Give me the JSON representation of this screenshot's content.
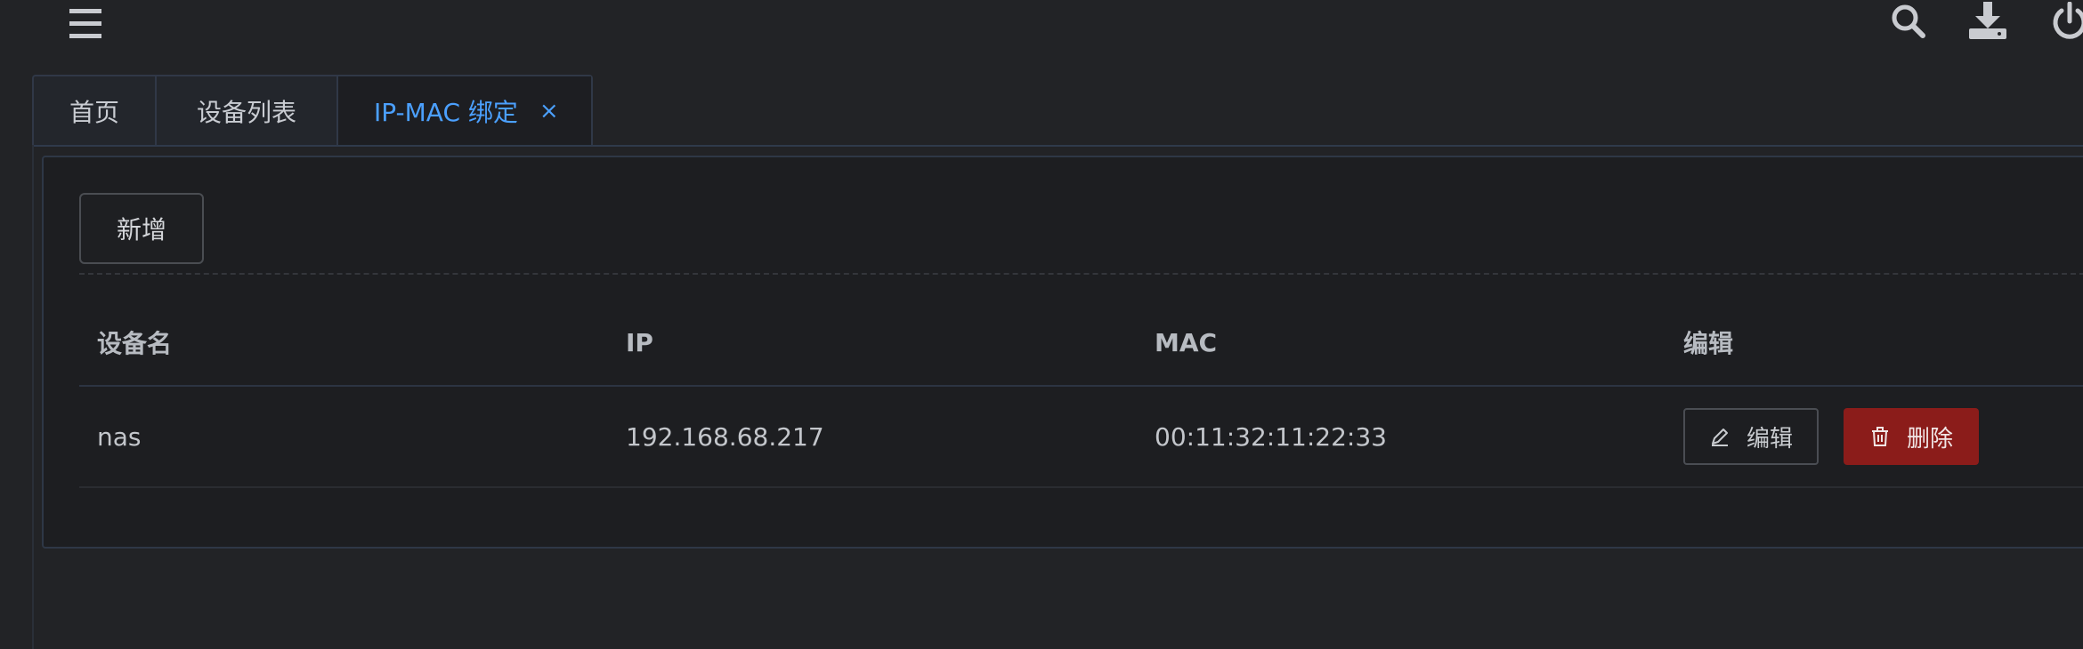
{
  "header": {
    "menu_icon": "hamburger-icon",
    "actions": [
      {
        "name": "search",
        "icon": "search-icon"
      },
      {
        "name": "download",
        "icon": "download-icon"
      },
      {
        "name": "power",
        "icon": "power-icon"
      }
    ]
  },
  "tabs": [
    {
      "label": "首页",
      "active": false
    },
    {
      "label": "设备列表",
      "active": false
    },
    {
      "label": "IP-MAC 绑定",
      "active": true,
      "close": "×"
    }
  ],
  "toolbar": {
    "add_label": "新增"
  },
  "table": {
    "columns": [
      "设备名",
      "IP",
      "MAC",
      "编辑"
    ],
    "rows": [
      {
        "name": "nas",
        "ip": "192.168.68.217",
        "mac": "00:11:32:11:22:33",
        "edit_label": "编辑",
        "delete_label": "删除"
      }
    ]
  },
  "colors": {
    "background": "#222326",
    "accent": "#4ba0ff",
    "danger": "#8b1c1a"
  }
}
